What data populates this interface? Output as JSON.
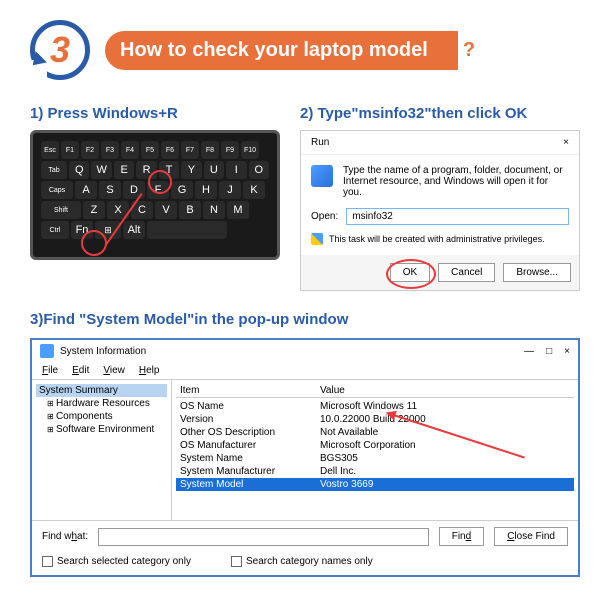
{
  "header": {
    "step_number": "3",
    "banner_text": "How to check your laptop model",
    "question_mark": "?"
  },
  "step1": {
    "title": "1) Press Windows+R",
    "key_r": "R",
    "keys_row1": [
      "Q",
      "W",
      "E",
      "R",
      "T",
      "Y",
      "U",
      "I",
      "O"
    ],
    "keys_row2": [
      "A",
      "S",
      "D",
      "F",
      "G",
      "H",
      "J",
      "K"
    ],
    "keys_row3": [
      "Z",
      "X",
      "C",
      "V",
      "B",
      "N",
      "M"
    ]
  },
  "step2": {
    "title": "2) Type\"msinfo32\"then click OK",
    "dialog_title": "Run",
    "close": "×",
    "description": "Type the name of a program, folder, document, or Internet resource, and Windows will open it for you.",
    "open_label": "Open:",
    "input_value": "msinfo32",
    "priv_text": "This task will be created with administrative privileges.",
    "btn_ok": "OK",
    "btn_cancel": "Cancel",
    "btn_browse": "Browse..."
  },
  "step3": {
    "title": "3)Find \"System Model\"in the pop-up window",
    "window_title": "System Information",
    "menu": {
      "file": "File",
      "edit": "Edit",
      "view": "View",
      "help": "Help"
    },
    "tree": {
      "root": "System Summary",
      "items": [
        "Hardware Resources",
        "Components",
        "Software Environment"
      ]
    },
    "headers": {
      "item": "Item",
      "value": "Value"
    },
    "rows": [
      {
        "key": "OS Name",
        "val": "Microsoft Windows 11"
      },
      {
        "key": "Version",
        "val": "10.0.22000 Build 22000"
      },
      {
        "key": "Other OS Description",
        "val": "Not Available"
      },
      {
        "key": "OS Manufacturer",
        "val": "Microsoft Corporation"
      },
      {
        "key": "System Name",
        "val": "BGS305"
      },
      {
        "key": "System Manufacturer",
        "val": "Dell Inc."
      },
      {
        "key": "System Model",
        "val": "Vostro 3669",
        "selected": true
      }
    ],
    "find_label": "Find what:",
    "btn_find": "Find",
    "btn_close_find": "Close Find",
    "chk1": "Search selected category only",
    "chk2": "Search category names only",
    "min": "—",
    "max": "□",
    "close": "×"
  }
}
